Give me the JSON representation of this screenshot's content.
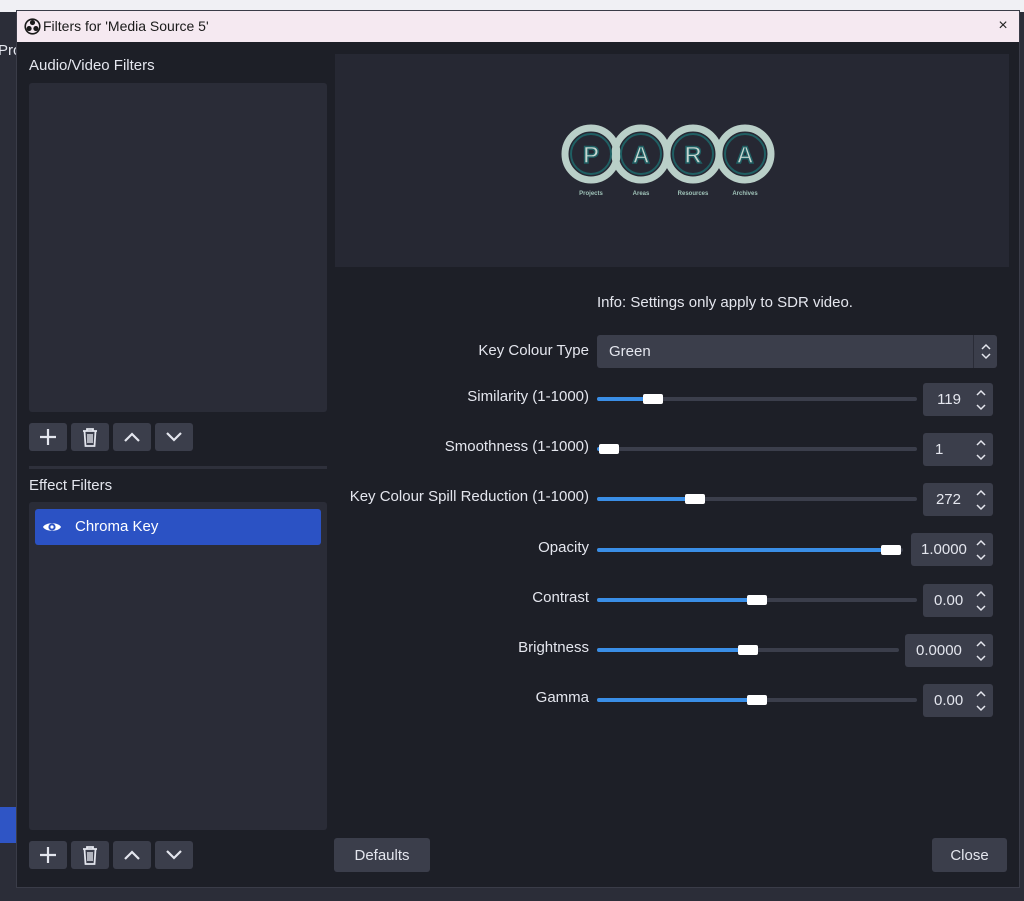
{
  "background": {
    "partial_text": "Pro"
  },
  "dialog": {
    "title": "Filters for 'Media Source 5'",
    "close_glyph": "×"
  },
  "audio_video": {
    "label": "Audio/Video Filters",
    "items": []
  },
  "effects": {
    "label": "Effect Filters",
    "items": [
      {
        "label": "Chroma Key",
        "visible": true,
        "selected": true
      }
    ]
  },
  "preview": {
    "logo_letters": [
      "P",
      "A",
      "R",
      "A"
    ],
    "logo_captions": [
      "Projects",
      "Areas",
      "Resources",
      "Archives"
    ]
  },
  "info": "Info: Settings only apply to SDR video.",
  "settings": {
    "key_colour_type": {
      "label": "Key Colour Type",
      "value": "Green"
    },
    "similarity": {
      "label": "Similarity (1-1000)",
      "value": "119",
      "fraction": 0.15
    },
    "smoothness": {
      "label": "Smoothness (1-1000)",
      "value": "1",
      "fraction": 0.0
    },
    "spill": {
      "label": "Key Colour Spill Reduction (1-1000)",
      "value": "272",
      "fraction": 0.29
    },
    "opacity": {
      "label": "Opacity",
      "value": "1.0000",
      "fraction": 1.0
    },
    "contrast": {
      "label": "Contrast",
      "value": "0.00",
      "fraction": 0.5
    },
    "brightness": {
      "label": "Brightness",
      "value": "0.0000",
      "fraction": 0.5
    },
    "gamma": {
      "label": "Gamma",
      "value": "0.00",
      "fraction": 0.5
    }
  },
  "buttons": {
    "defaults": "Defaults",
    "close": "Close"
  },
  "colors": {
    "accent": "#3a8ee6",
    "selection": "#2b52c4",
    "dialog_bg": "#1d1f27",
    "panel_bg": "#2a2c37",
    "titlebar": "#f5e9f1"
  }
}
